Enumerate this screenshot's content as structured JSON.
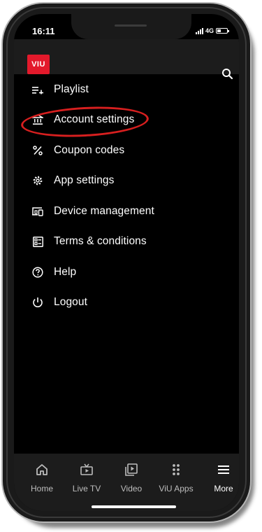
{
  "status_bar": {
    "time": "16:11",
    "network": "4G"
  },
  "header": {
    "logo_text": "VIU",
    "search_icon": "search-icon"
  },
  "menu": {
    "items": [
      {
        "label": "Playlist",
        "icon": "playlist-add-icon"
      },
      {
        "label": "Account settings",
        "icon": "bank-icon",
        "highlighted": true
      },
      {
        "label": "Coupon codes",
        "icon": "percent-icon"
      },
      {
        "label": "App settings",
        "icon": "gear-icon"
      },
      {
        "label": "Device management",
        "icon": "devices-icon"
      },
      {
        "label": "Terms & conditions",
        "icon": "document-icon"
      },
      {
        "label": "Help",
        "icon": "help-icon"
      },
      {
        "label": "Logout",
        "icon": "power-icon"
      }
    ]
  },
  "bottom_nav": {
    "items": [
      {
        "label": "Home",
        "icon": "home-icon"
      },
      {
        "label": "Live TV",
        "icon": "tv-icon"
      },
      {
        "label": "Video",
        "icon": "video-icon"
      },
      {
        "label": "ViU Apps",
        "icon": "apps-grid-icon"
      },
      {
        "label": "More",
        "icon": "hamburger-icon",
        "active": true
      }
    ]
  },
  "colors": {
    "brand_red": "#e3192b",
    "highlight_ring": "#d71f1f",
    "background": "#000000",
    "bar_background": "#1c1c1c"
  }
}
